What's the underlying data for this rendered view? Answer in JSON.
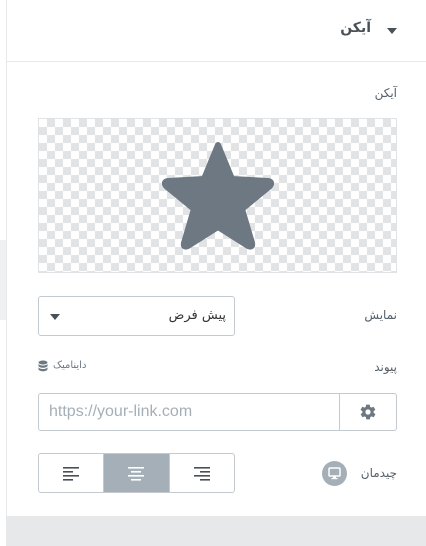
{
  "section": {
    "title": "آیکن"
  },
  "icon_control": {
    "label": "آیکن",
    "selected_icon": "star-icon"
  },
  "view": {
    "label": "نمایش",
    "value": "پیش فرض"
  },
  "link": {
    "label": "پیوند",
    "dynamic_label": "داینامیک",
    "placeholder": "https://your-link.com",
    "value": ""
  },
  "alignment": {
    "label": "چیدمان",
    "options": [
      "align-left",
      "align-center",
      "align-right"
    ],
    "selected": "align-center"
  },
  "colors": {
    "accent": "#a4afb7",
    "icon": "#6d7882",
    "text": "#495157"
  }
}
